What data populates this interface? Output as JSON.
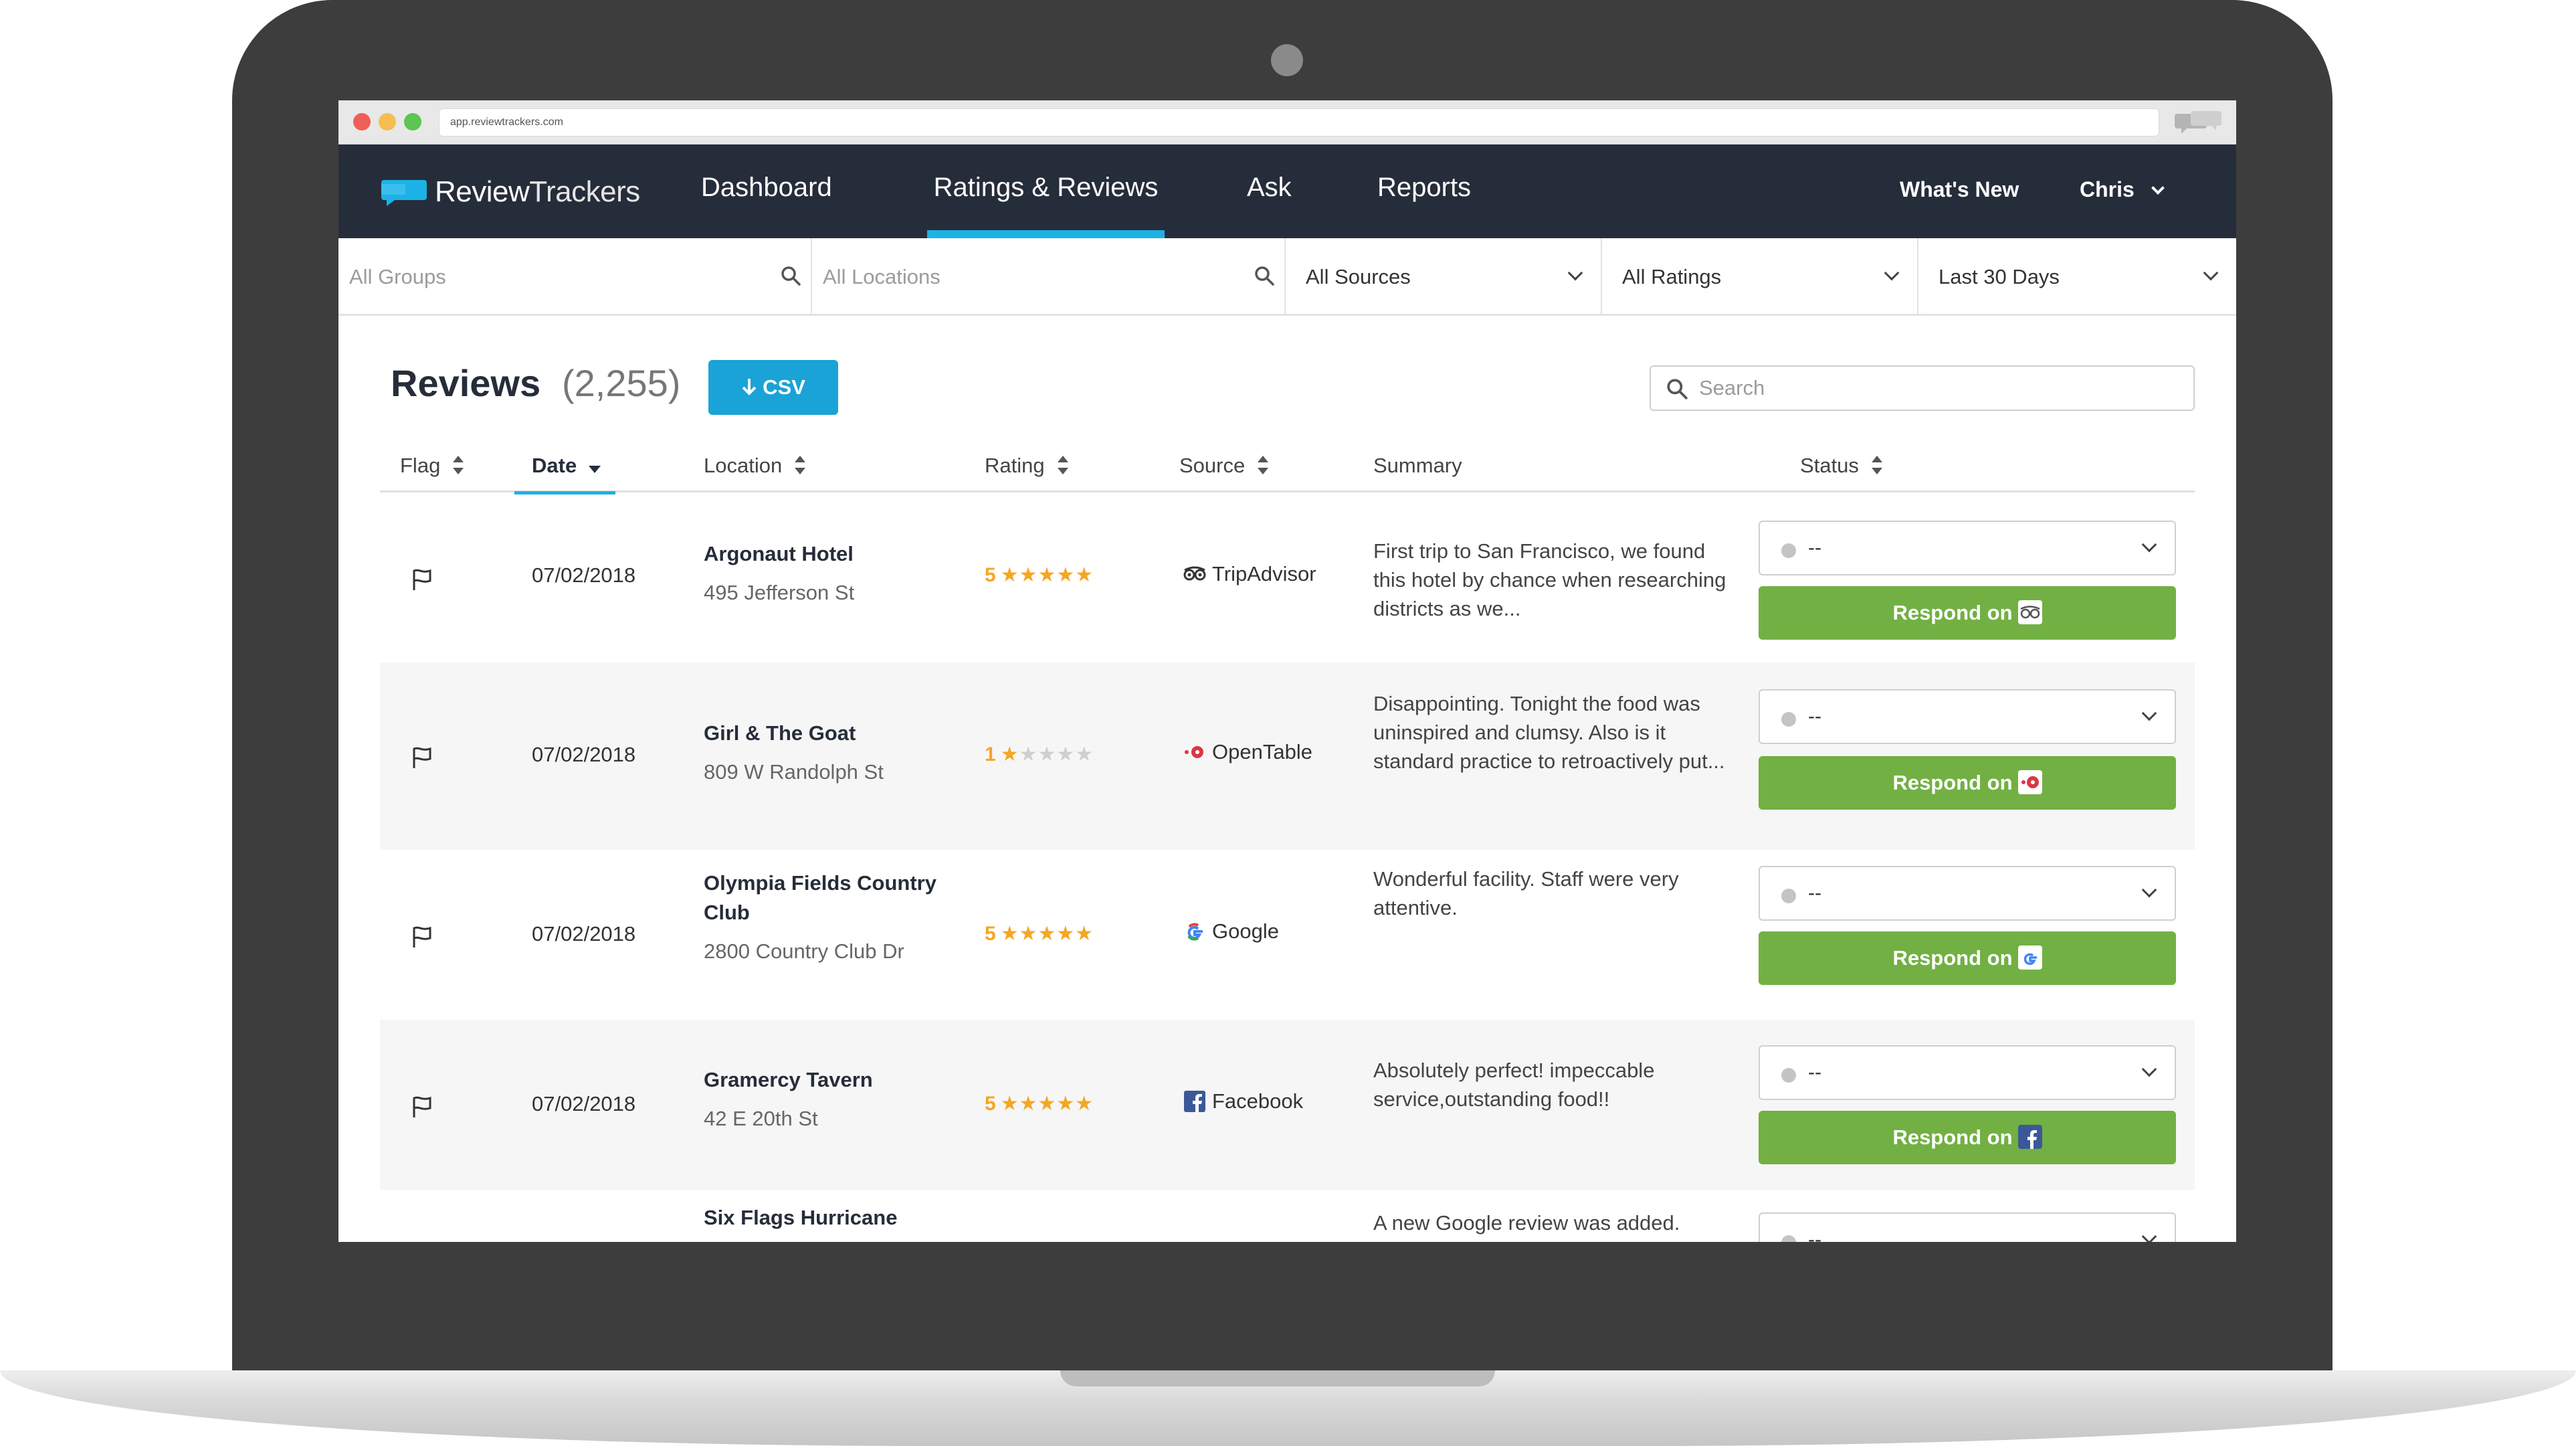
{
  "browser": {
    "url": "app.reviewtrackers.com"
  },
  "app": {
    "logo_text_a": "Review",
    "logo_text_b": "Trackers"
  },
  "nav": {
    "dashboard": "Dashboard",
    "ratings_reviews": "Ratings & Reviews",
    "ask": "Ask",
    "reports": "Reports"
  },
  "header": {
    "whats_new": "What's New",
    "user": "Chris"
  },
  "filters": {
    "groups_placeholder": "All Groups",
    "locations_placeholder": "All Locations",
    "sources": "All Sources",
    "ratings": "All Ratings",
    "date_range": "Last 30 Days"
  },
  "reviews": {
    "title": "Reviews",
    "count": "(2,255)",
    "csv_label": "CSV",
    "search_placeholder": "Search"
  },
  "columns": {
    "flag": "Flag",
    "date": "Date",
    "location": "Location",
    "rating": "Rating",
    "source": "Source",
    "summary": "Summary",
    "status": "Status"
  },
  "rows": [
    {
      "date": "07/02/2018",
      "location_name": "Argonaut Hotel",
      "location_address": "495 Jefferson St",
      "rating": "5",
      "stars": 5,
      "source": "TripAdvisor",
      "summary": "First trip to San Francisco, we found this hotel by chance when researching districts as we...",
      "status": "--",
      "respond": "Respond on"
    },
    {
      "date": "07/02/2018",
      "location_name": "Girl & The Goat",
      "location_address": "809 W Randolph St",
      "rating": "1",
      "stars": 1,
      "source": "OpenTable",
      "summary": "Disappointing. Tonight the food was uninspired and clumsy. Also is it standard practice to retroactively put...",
      "status": "--",
      "respond": "Respond on"
    },
    {
      "date": "07/02/2018",
      "location_name": "Olympia Fields Country Club",
      "location_address": "2800 Country Club Dr",
      "rating": "5",
      "stars": 5,
      "source": "Google",
      "summary": "Wonderful facility. Staff were very attentive.",
      "status": "--",
      "respond": "Respond on"
    },
    {
      "date": "07/02/2018",
      "location_name": "Gramercy Tavern",
      "location_address": "42 E 20th St",
      "rating": "5",
      "stars": 5,
      "source": "Facebook",
      "summary": "Absolutely perfect! impeccable service,outstanding food!!",
      "status": "--",
      "respond": "Respond on"
    },
    {
      "location_name": "Six Flags Hurricane",
      "summary": "A new Google review was added.",
      "status": "--"
    }
  ],
  "icons": {
    "flag": "flag-icon",
    "search": "search-icon",
    "sort": "sort-icon",
    "download": "arrow-down-icon",
    "tripadvisor": "tripadvisor-icon",
    "opentable": "opentable-icon",
    "google": "google-icon",
    "facebook": "facebook-icon"
  },
  "colors": {
    "header_bg": "#262d3a",
    "accent": "#1cb2e6",
    "csv_button": "#1aa3d6",
    "respond_button": "#72b043",
    "star": "#f5a623"
  }
}
